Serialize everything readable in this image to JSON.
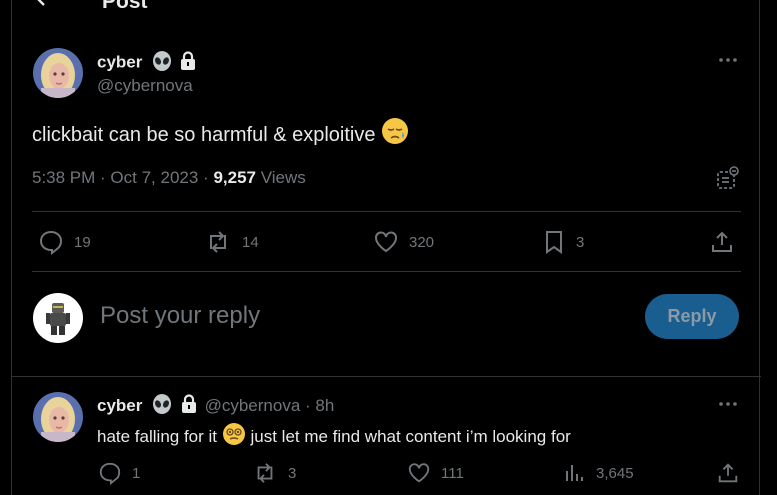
{
  "header": {
    "title": "Post"
  },
  "post": {
    "author_name": "cyber",
    "handle": "@cybernova",
    "text": "clickbait can be so harmful & exploitive",
    "emoji": "sad-face",
    "time": "5:38 PM · Oct 7, 2023 ·",
    "views_count": "9,257",
    "views_label": "Views"
  },
  "actions": {
    "replies": "19",
    "reposts": "14",
    "likes": "320",
    "bookmarks": "3"
  },
  "reply_box": {
    "placeholder": "Post your reply",
    "button_label": "Reply"
  },
  "reply": {
    "author_name": "cyber",
    "handle": "@cybernova",
    "time": "· 8h",
    "text_before": "hate falling for it",
    "emoji": "dizzy-face",
    "text_after": "just let me find what content i’m looking for",
    "replies": "1",
    "reposts": "3",
    "likes": "111",
    "views": "3,645"
  },
  "colors": {
    "background": "#000000",
    "text": "#e7e9ea",
    "muted": "#71767b",
    "accent_button": "#1a5e8f",
    "divider": "#2f3336"
  }
}
